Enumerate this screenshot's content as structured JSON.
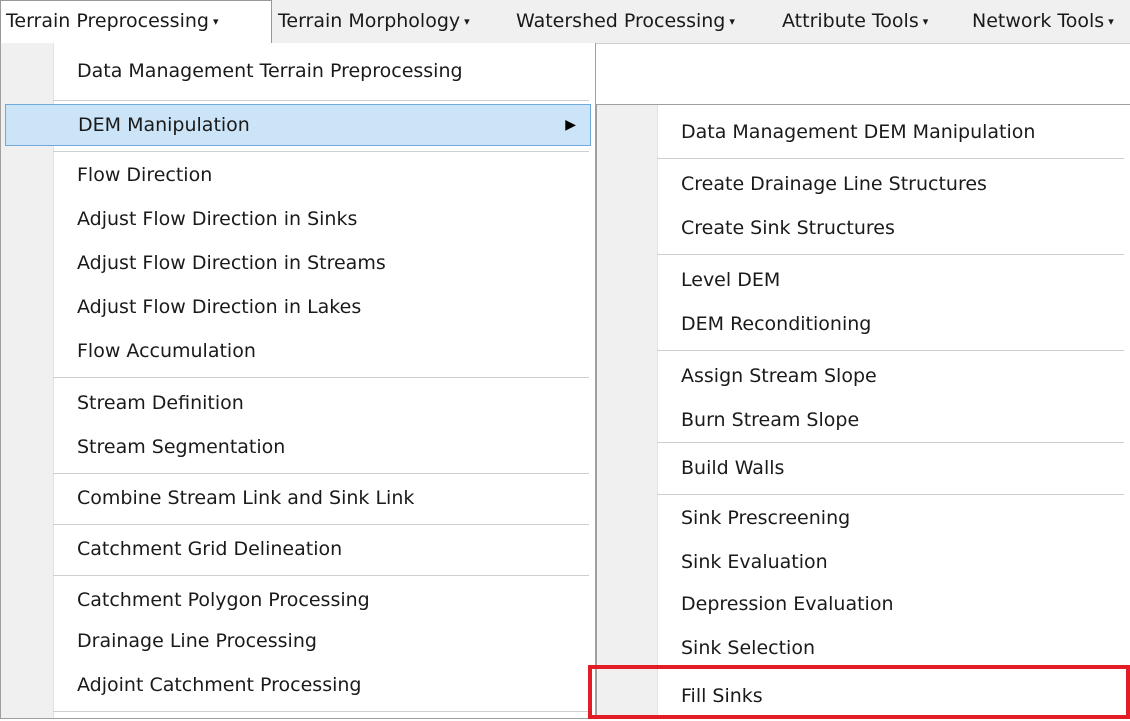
{
  "menubar": {
    "items": [
      {
        "label": "Terrain Preprocessing"
      },
      {
        "label": "Terrain Morphology"
      },
      {
        "label": "Watershed Processing"
      },
      {
        "label": "Attribute Tools"
      },
      {
        "label": "Network Tools"
      }
    ],
    "caret": "▾"
  },
  "main_menu": {
    "items": [
      {
        "label": "Data Management Terrain Preprocessing"
      },
      {
        "label": "DEM Manipulation"
      },
      {
        "label": "Flow Direction"
      },
      {
        "label": "Adjust Flow Direction in Sinks"
      },
      {
        "label": "Adjust Flow Direction in Streams"
      },
      {
        "label": "Adjust Flow Direction in Lakes"
      },
      {
        "label": "Flow Accumulation"
      },
      {
        "label": "Stream Definition"
      },
      {
        "label": "Stream Segmentation"
      },
      {
        "label": "Combine Stream Link and Sink Link"
      },
      {
        "label": "Catchment Grid Delineation"
      },
      {
        "label": "Catchment Polygon Processing"
      },
      {
        "label": "Drainage Line Processing"
      },
      {
        "label": "Adjoint Catchment Processing"
      }
    ],
    "submenu_arrow": "▶"
  },
  "sub_menu": {
    "items": [
      {
        "label": "Data Management DEM Manipulation"
      },
      {
        "label": "Create Drainage Line Structures"
      },
      {
        "label": "Create Sink Structures"
      },
      {
        "label": "Level DEM"
      },
      {
        "label": "DEM Reconditioning"
      },
      {
        "label": "Assign Stream Slope"
      },
      {
        "label": "Burn Stream Slope"
      },
      {
        "label": "Build Walls"
      },
      {
        "label": "Sink Prescreening"
      },
      {
        "label": "Sink Evaluation"
      },
      {
        "label": "Depression Evaluation"
      },
      {
        "label": "Sink Selection"
      },
      {
        "label": "Fill Sinks"
      }
    ]
  },
  "colors": {
    "highlight": "#cce4f7",
    "highlight_border": "#6ea8dc",
    "annotation_box": "#e21d26"
  }
}
